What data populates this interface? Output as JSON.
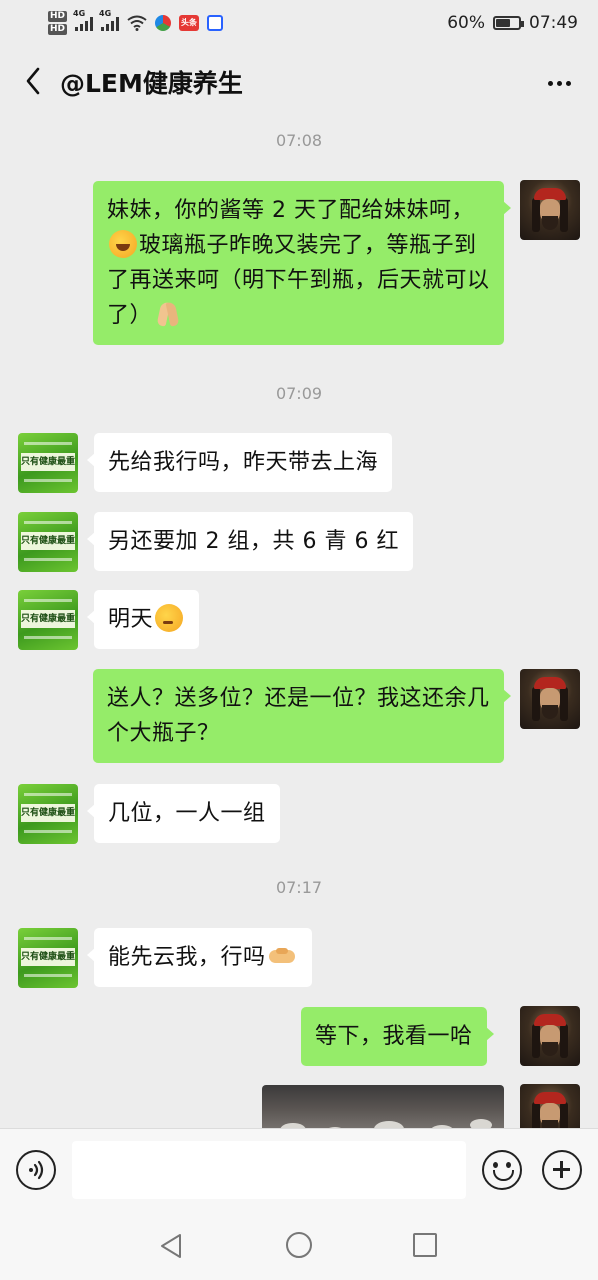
{
  "status_bar": {
    "hd_top": "HD",
    "hd_bottom": "HD",
    "sig1_label": "4G",
    "sig2_label": "4G",
    "news_badge": "头条",
    "battery_text": "60%",
    "battery_level": 0.6,
    "time": "07:49"
  },
  "header": {
    "title": "@LEM健康养生",
    "back_icon": "chevron-left-icon",
    "more_icon": "more-dots-icon"
  },
  "contact_avatar_caption": "只有健康最重要",
  "messages": {
    "ts1": "07:08",
    "m1": {
      "direction": "out",
      "p1": "妹妹，你的酱等 2 天了配给妹妹呵，",
      "emoji1": "laughing-crying-emoji",
      "p2": "玻璃瓶子昨晚又装完了，等瓶子到了再送来呵（明下午到瓶，后天就可以了）",
      "emoji2": "folded-hands-emoji"
    },
    "ts2": "07:09",
    "m2": {
      "direction": "in",
      "text": "先给我行吗，昨天带去上海"
    },
    "m3": {
      "direction": "in",
      "text": "另还要加 2 组，共 6 青 6 红"
    },
    "m4": {
      "direction": "in",
      "text": "明天",
      "emoji": "thinking-face-emoji"
    },
    "m5": {
      "direction": "out",
      "text": "送人？送多位？还是一位？我这还余几个大瓶子？"
    },
    "m6": {
      "direction": "in",
      "text": "几位，一人一组"
    },
    "ts3": "07:17",
    "m7": {
      "direction": "in",
      "text": "能先云我，行吗",
      "emoji": "handshake-emoji"
    },
    "m8": {
      "direction": "out",
      "text": "等下，我看一哈"
    },
    "m9": {
      "direction": "out",
      "type": "image"
    }
  },
  "input_bar": {
    "placeholder": "",
    "voice_icon": "voice-icon",
    "emoji_icon": "smiley-icon",
    "plus_icon": "plus-icon"
  },
  "nav_bar": {
    "back_icon": "triangle-back-icon",
    "home_icon": "circle-home-icon",
    "recent_icon": "square-recent-icon"
  }
}
